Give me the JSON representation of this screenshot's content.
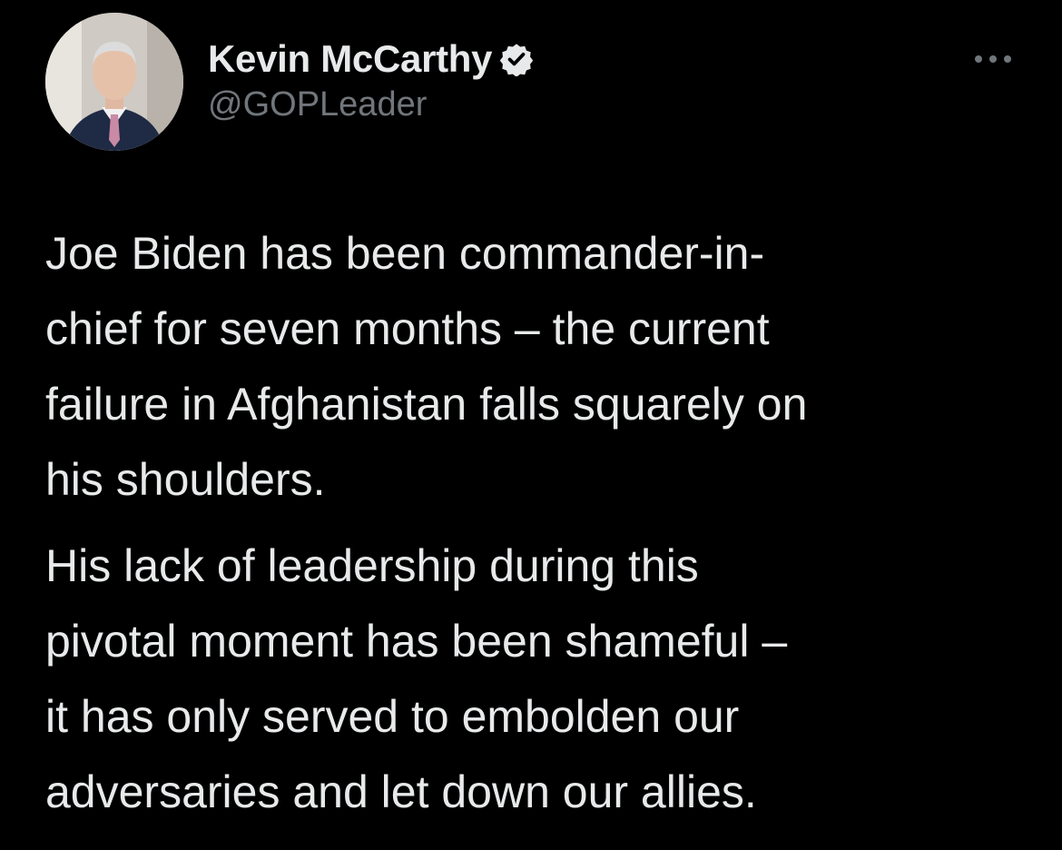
{
  "tweet": {
    "author": {
      "display_name": "Kevin McCarthy",
      "handle": "@GOPLeader",
      "verified": true
    },
    "more_icon": "more-horizontal-icon",
    "verified_icon": "verified-badge-icon",
    "paragraphs": [
      "Joe Biden has been commander-in-\nchief for seven months – the current\nfailure in Afghanistan falls squarely on\nhis shoulders.",
      "His lack of leadership during this\npivotal moment has been shameful –\nit has only served to embolden our\nadversaries and let down our allies."
    ]
  },
  "colors": {
    "background": "#000000",
    "primary_text": "#e7e9ea",
    "secondary_text": "#71767b"
  }
}
